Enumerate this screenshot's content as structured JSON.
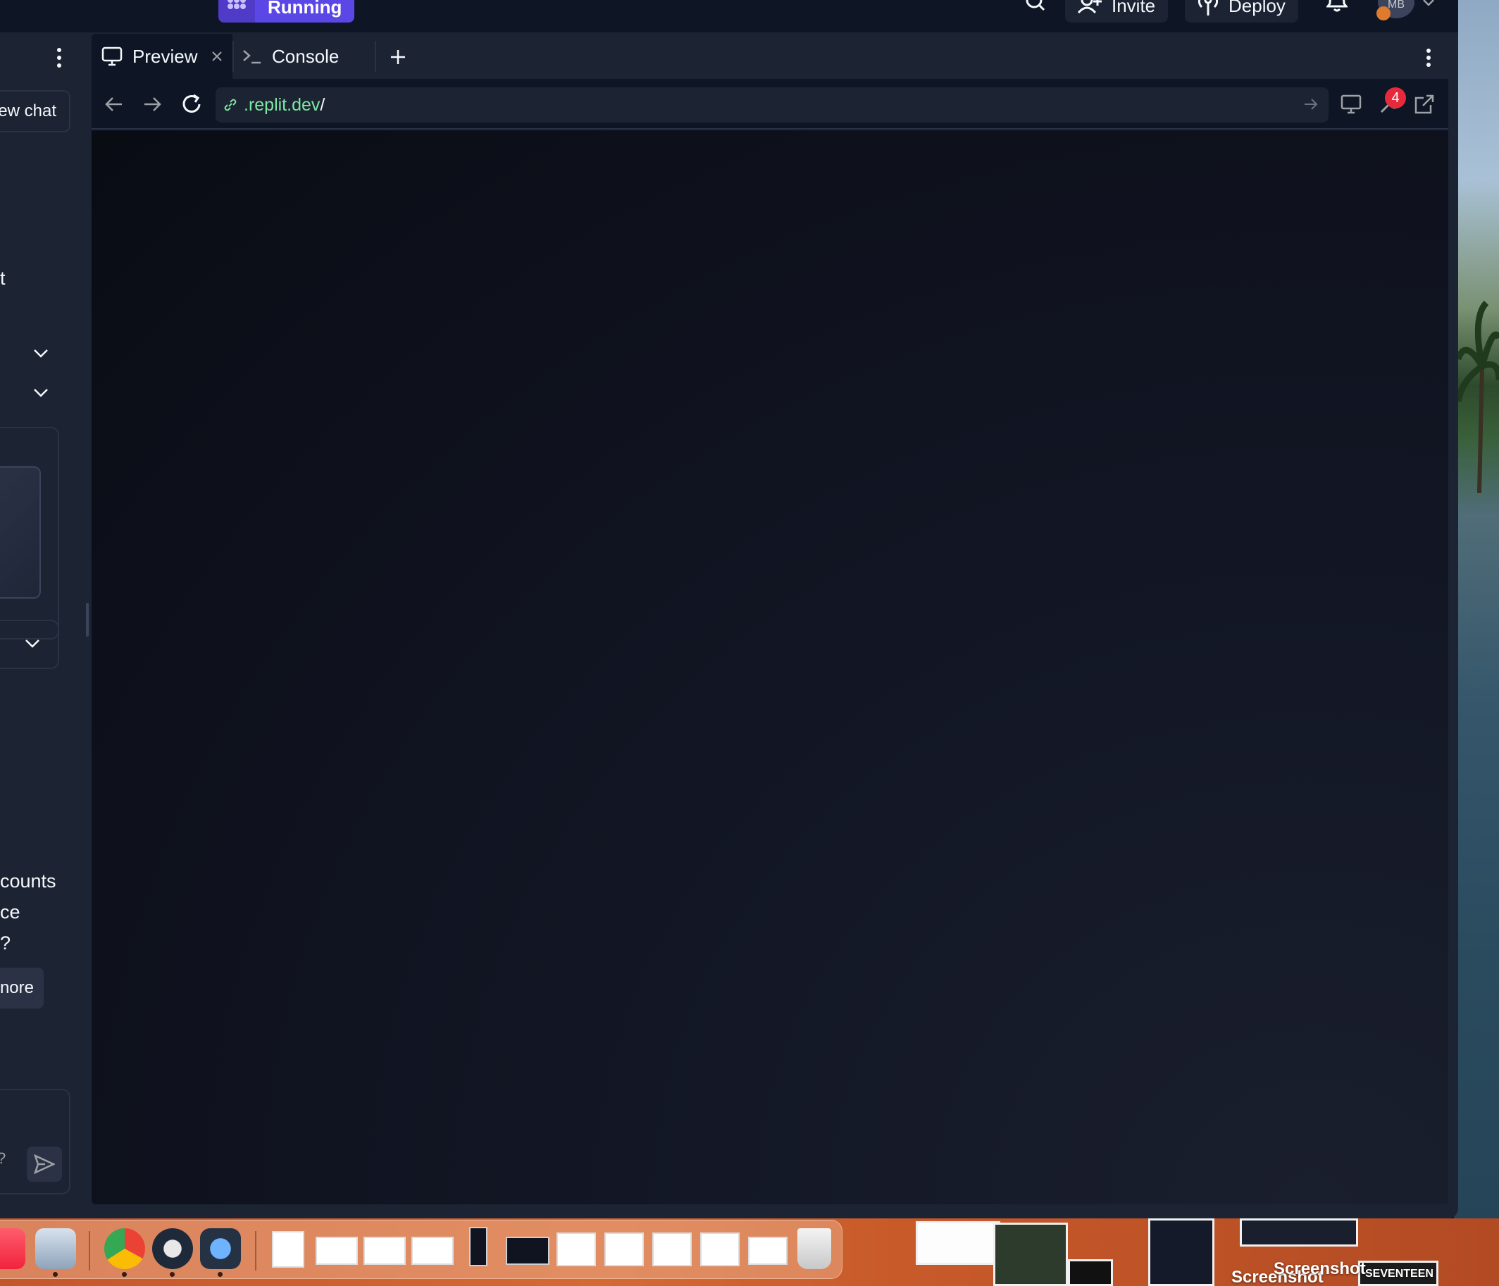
{
  "topbar": {
    "run_label": "Running",
    "invite_label": "Invite",
    "deploy_label": "Deploy",
    "avatar_initials": "MB"
  },
  "left_panel": {
    "new_chat_label": "ew chat",
    "fragment_t": "t",
    "fragment_counts": "counts",
    "fragment_ce": "ce",
    "fragment_q": "?",
    "more_label": "nore",
    "input_fragment": "?"
  },
  "tabs": [
    {
      "label": "Preview",
      "icon": "monitor-icon",
      "active": true
    },
    {
      "label": "Console",
      "icon": "terminal-icon",
      "active": false
    }
  ],
  "url_bar": {
    "host": ".replit.dev",
    "path": "/",
    "devtools_badge": "4"
  },
  "desktop": {
    "file_label_1": "Screenshot",
    "file_label_2": "Screenshot",
    "file_label_3": "SEVENTEEN"
  },
  "colors": {
    "run_accent": "#5b47e6",
    "url_host": "#7ce8a0",
    "badge": "#e52b3b"
  }
}
